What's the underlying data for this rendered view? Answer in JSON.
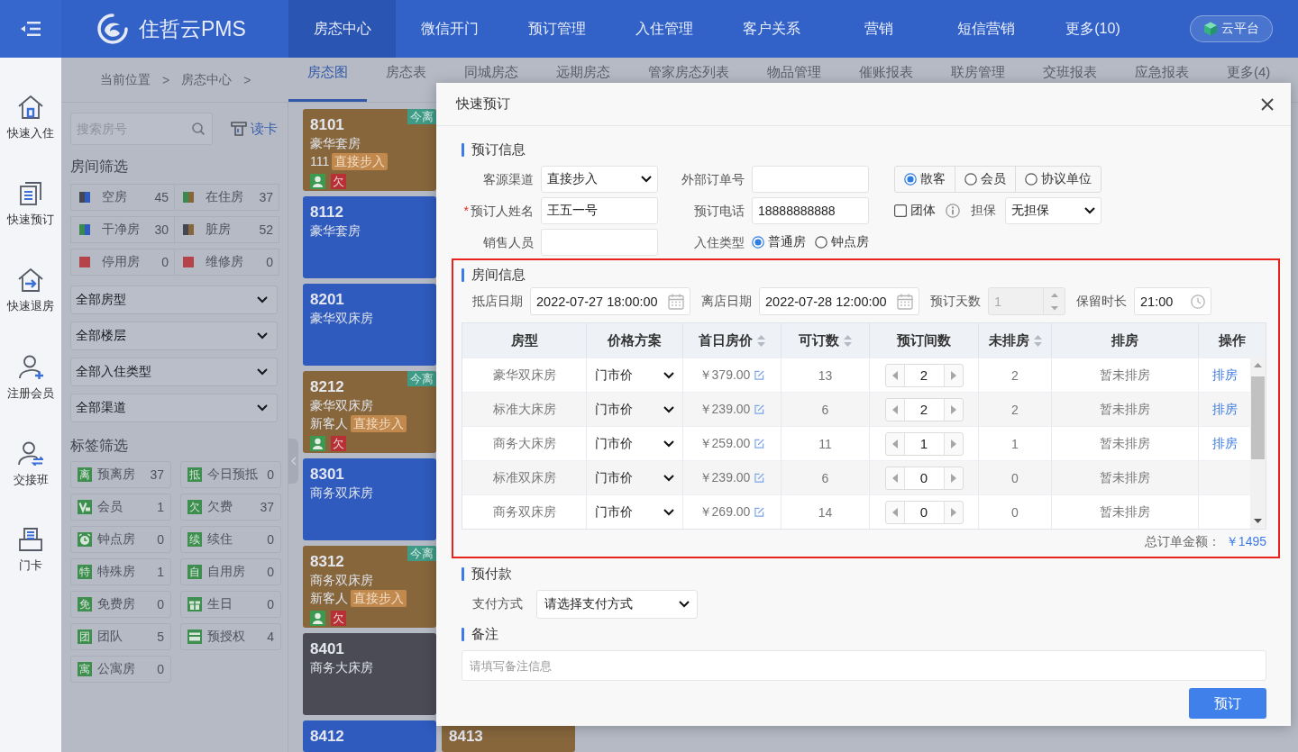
{
  "topbar": {
    "logo": "住哲云PMS",
    "nav": [
      {
        "label": "房态中心",
        "selected": true
      },
      {
        "label": "微信开门",
        "selected": false
      },
      {
        "label": "预订管理",
        "selected": false
      },
      {
        "label": "入住管理",
        "selected": false
      },
      {
        "label": "客户关系",
        "selected": false
      },
      {
        "label": "营销",
        "selected": false
      },
      {
        "label": "短信营销",
        "selected": false
      },
      {
        "label": "更多(10)",
        "selected": false
      }
    ],
    "cloud_button": "云平台"
  },
  "sidebar": [
    {
      "kind": "checkin",
      "label": "快速入住"
    },
    {
      "kind": "booking",
      "label": "快速预订"
    },
    {
      "kind": "checkout",
      "label": "快速退房"
    },
    {
      "kind": "member",
      "label": "注册会员"
    },
    {
      "kind": "shift",
      "label": "交接班"
    },
    {
      "kind": "card",
      "label": "门卡"
    }
  ],
  "breadcrumb": [
    {
      "kind": "item",
      "text": "当前位置"
    },
    {
      "kind": "separator",
      "text": ">"
    },
    {
      "kind": "item",
      "text": "房态中心"
    },
    {
      "kind": "separator",
      "text": ">"
    }
  ],
  "tabs": [
    {
      "label": "房态图",
      "selected": true
    },
    {
      "label": "房态表",
      "selected": false
    },
    {
      "label": "同城房态",
      "selected": false
    },
    {
      "label": "远期房态",
      "selected": false
    },
    {
      "label": "管家房态列表",
      "selected": false
    },
    {
      "label": "物品管理",
      "selected": false
    },
    {
      "label": "催账报表",
      "selected": false
    },
    {
      "label": "联房管理",
      "selected": false
    },
    {
      "label": "交班报表",
      "selected": false
    },
    {
      "label": "应急报表",
      "selected": false
    },
    {
      "label": "更多(4)",
      "selected": false
    }
  ],
  "filter_panel": {
    "search": {
      "placeholder": "搜索房号"
    },
    "read_card": "读卡",
    "room_filter_title": "房间筛选",
    "room_filters": [
      {
        "label": "空房",
        "count": "45",
        "swatch": [
          {
            "color": "#44474f"
          },
          {
            "color": "#2f5bbf"
          }
        ]
      },
      {
        "label": "在住房",
        "count": "37",
        "swatch": [
          {
            "color": "#3a8a4f"
          },
          {
            "color": "#87663c"
          }
        ]
      },
      {
        "label": "干净房",
        "count": "30",
        "swatch": [
          {
            "color": "#3a8a4f"
          },
          {
            "color": "#2f5bbf"
          }
        ]
      },
      {
        "label": "脏房",
        "count": "52",
        "swatch": [
          {
            "color": "#44474f"
          },
          {
            "color": "#87663c"
          }
        ]
      },
      {
        "label": "停用房",
        "count": "0",
        "swatch": [
          {
            "color": "#b5434a"
          }
        ]
      },
      {
        "label": "维修房",
        "count": "0",
        "swatch": [
          {
            "color": "#b5434a"
          }
        ]
      }
    ],
    "selects": [
      "全部房型",
      "全部楼层",
      "全部入住类型",
      "全部渠道"
    ],
    "tag_filter_title": "标签筛选",
    "tag_filters": [
      {
        "kind": "text",
        "badge": "离",
        "label": "预离房",
        "count": "37"
      },
      {
        "kind": "text",
        "badge": "抵",
        "label": "今日预抵",
        "count": "0"
      },
      {
        "kind": "vip",
        "label": "会员",
        "count": "1"
      },
      {
        "kind": "text",
        "badge": "欠",
        "label": "欠费",
        "count": "37"
      },
      {
        "kind": "clock",
        "label": "钟点房",
        "count": "0"
      },
      {
        "kind": "text",
        "badge": "续",
        "label": "续住",
        "count": "0"
      },
      {
        "kind": "text",
        "badge": "特",
        "label": "特殊房",
        "count": "1"
      },
      {
        "kind": "text",
        "badge": "自",
        "label": "自用房",
        "count": "0"
      },
      {
        "kind": "text",
        "badge": "免",
        "label": "免费房",
        "count": "0"
      },
      {
        "kind": "gift",
        "label": "生日",
        "count": "0"
      },
      {
        "kind": "text",
        "badge": "团",
        "label": "团队",
        "count": "5"
      },
      {
        "kind": "card",
        "label": "预授权",
        "count": "4"
      },
      {
        "kind": "text",
        "badge": "寓",
        "label": "公寓房",
        "count": "0"
      }
    ]
  },
  "rooms": [
    {
      "number": "8101",
      "type": "豪华套房",
      "color": "#87663c",
      "guest": "111",
      "source": "直接步入",
      "checked_in": true,
      "arrears": "欠",
      "tag": "今离"
    },
    {
      "number": "8112",
      "type": "豪华套房",
      "color": "#2f5bbf",
      "checked_in": false
    },
    {
      "number": "8201",
      "type": "豪华双床房",
      "color": "#2f5bbf",
      "checked_in": false
    },
    {
      "number": "8212",
      "type": "豪华双床房",
      "color": "#87663c",
      "guest": "新客人",
      "source": "直接步入",
      "checked_in": true,
      "arrears": "欠",
      "tag": "今离"
    },
    {
      "number": "8301",
      "type": "商务双床房",
      "color": "#2f5bbf",
      "checked_in": false
    },
    {
      "number": "8312",
      "type": "商务双床房",
      "color": "#87663c",
      "guest": "新客人",
      "source": "直接步入",
      "checked_in": true,
      "arrears": "欠",
      "tag": "今离"
    },
    {
      "number": "8401",
      "type": "商务大床房",
      "color": "#4a4b55",
      "checked_in": false
    },
    {
      "number": "8412",
      "color": "#2f5bbf",
      "checked_in": false
    }
  ],
  "rooms_next_column": [
    {
      "number": "8413",
      "color": "#87663c"
    }
  ],
  "modal": {
    "title": "快速预订",
    "booking": {
      "title": "预订信息",
      "source": {
        "label": "客源渠道",
        "value": "直接步入"
      },
      "external_no": {
        "label": "外部订单号"
      },
      "guest_type": [
        {
          "label": "散客",
          "selected": true
        },
        {
          "label": "会员",
          "selected": false
        },
        {
          "label": "协议单位",
          "selected": false
        }
      ],
      "booker": {
        "marker": "*",
        "label": "预订人姓名",
        "value": "王五一号"
      },
      "phone": {
        "label": "预订电话",
        "value": "18888888888"
      },
      "group": {
        "label": "团体",
        "checked": false
      },
      "guarantee": {
        "label": "担保",
        "value": "无担保"
      },
      "sales": {
        "label": "销售人员"
      },
      "stay_type": {
        "label": "入住类型",
        "options": [
          {
            "label": "普通房",
            "selected": true
          },
          {
            "label": "钟点房",
            "selected": false
          }
        ]
      }
    },
    "room_info": {
      "title": "房间信息",
      "highlighted": true,
      "arrival": {
        "label": "抵店日期",
        "value": "2022-07-27 18:00:00"
      },
      "departure": {
        "label": "离店日期",
        "value": "2022-07-28 12:00:00"
      },
      "nights": {
        "label": "预订天数",
        "value": "1",
        "disabled": true
      },
      "hold": {
        "label": "保留时长",
        "value": "21:00"
      },
      "table": {
        "columns": [
          {
            "label": "房型",
            "sortable": false
          },
          {
            "label": "价格方案",
            "sortable": false
          },
          {
            "label": "首日房价",
            "sortable": true
          },
          {
            "label": "可订数",
            "sortable": true
          },
          {
            "label": "预订间数",
            "sortable": false
          },
          {
            "label": "未排房",
            "sortable": true
          },
          {
            "label": "排房",
            "sortable": false
          },
          {
            "label": "操作",
            "sortable": false
          }
        ],
        "rows": [
          {
            "room_type": "豪华双床房",
            "plan": "门市价",
            "price": "￥379.00",
            "available": "13",
            "count": "2",
            "unassigned": "2",
            "assignment": "暂未排房",
            "action": "排房"
          },
          {
            "room_type": "标准大床房",
            "plan": "门市价",
            "price": "￥239.00",
            "available": "6",
            "count": "2",
            "unassigned": "2",
            "assignment": "暂未排房",
            "action": "排房"
          },
          {
            "room_type": "商务大床房",
            "plan": "门市价",
            "price": "￥259.00",
            "available": "11",
            "count": "1",
            "unassigned": "1",
            "assignment": "暂未排房",
            "action": "排房"
          },
          {
            "room_type": "标准双床房",
            "plan": "门市价",
            "price": "￥239.00",
            "available": "6",
            "count": "0",
            "unassigned": "0",
            "assignment": "暂未排房"
          },
          {
            "room_type": "商务双床房",
            "plan": "门市价",
            "price": "￥269.00",
            "available": "14",
            "count": "0",
            "unassigned": "0",
            "assignment": "暂未排房"
          }
        ]
      },
      "total_label": "总订单金额：",
      "total_value": "￥1495"
    },
    "prepay": {
      "title": "预付款",
      "method": {
        "label": "支付方式",
        "value": "请选择支付方式"
      }
    },
    "remark": {
      "title": "备注",
      "placeholder": "请填写备注信息"
    },
    "submit": "预订"
  }
}
